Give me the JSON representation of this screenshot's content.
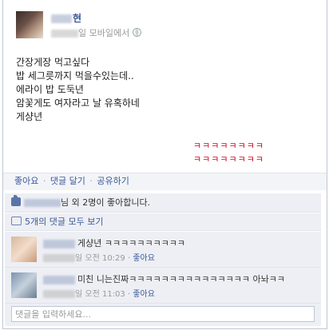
{
  "post": {
    "author_suffix": "현",
    "meta_text": "일 모바일에서",
    "lines": [
      "간장게장 먹고싶다",
      "밥 세그릇까지 먹을수있는데..",
      "",
      "에라이 밥 도둑년",
      "",
      "암꽃게도 여자라고 날 유혹하네",
      "게샹년"
    ],
    "laugh_lines": [
      "ㅋㅋㅋㅋㅋㅋㅋㅋ",
      "ㅋㅋㅋㅋㅋㅋㅋㅋ"
    ]
  },
  "actions": {
    "like": "좋아요",
    "comment": "댓글 달기",
    "share": "공유하기",
    "sep": "·"
  },
  "likes": {
    "text": "님 외 2명이 좋아합니다."
  },
  "view_comments": "5개의 댓글 모두 보기",
  "comments": [
    {
      "text": "게샹년 ㅋㅋㅋㅋㅋㅋㅋㅋㅋㅋ",
      "time": "일 오전 10:29",
      "like": "좋아요"
    },
    {
      "text": "미친 니는진짜ㅋㅋㅋㅋㅋㅋㅋㅋㅋㅋㅋㅋㅋㅋㅋ 아놔ㅋㅋ",
      "time": "일 오전 11:03",
      "like": "좋아요"
    }
  ],
  "comment_input": {
    "placeholder": "댓글을 입력하세요..."
  },
  "colors": {
    "link": "#3b5998",
    "laugh": "#d0021b",
    "panel": "#edeff4"
  }
}
